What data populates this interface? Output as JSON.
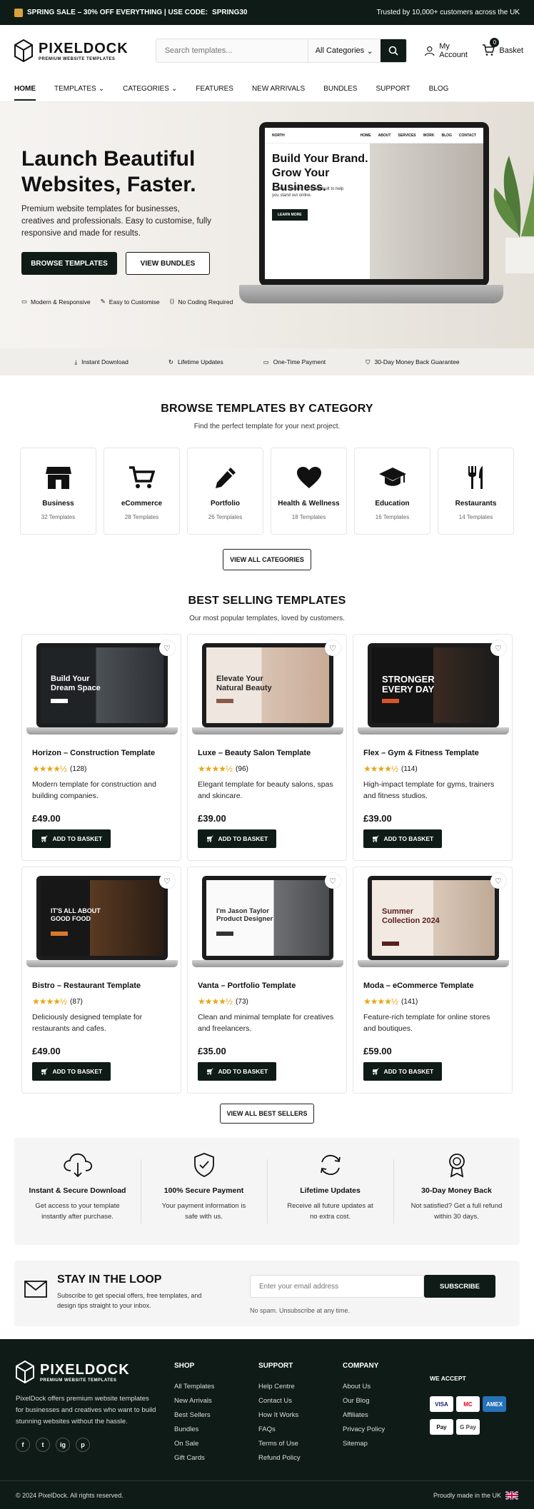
{
  "topbar": {
    "promo": "SPRING SALE – 30% OFF EVERYTHING | USE CODE:",
    "code": "SPRING30",
    "trust": "Trusted by 10,000+ customers across the UK"
  },
  "brand": {
    "name": "PIXELDOCK",
    "tagline": "PREMIUM WEBSITE TEMPLATES"
  },
  "search": {
    "placeholder": "Search templates...",
    "category": "All Categories"
  },
  "header": {
    "account": "My Account",
    "basket": "Basket",
    "basket_count": "0"
  },
  "nav": [
    "HOME",
    "TEMPLATES",
    "CATEGORIES",
    "FEATURES",
    "NEW ARRIVALS",
    "BUNDLES",
    "SUPPORT",
    "BLOG"
  ],
  "hero": {
    "title": "Launch Beautiful Websites, Faster.",
    "description": "Premium website templates for businesses, creatives and professionals. Easy to customise, fully responsive and made for results.",
    "primary_btn": "BROWSE TEMPLATES",
    "secondary_btn": "VIEW BUNDLES",
    "features": [
      "Modern & Responsive",
      "Easy to Customise",
      "No Coding Required"
    ],
    "screen": {
      "brand": "NORTH",
      "nav": [
        "HOME",
        "ABOUT",
        "SERVICES",
        "WORK",
        "BLOG",
        "CONTACT"
      ],
      "title": "Build Your Brand. Grow Your Business.",
      "text": "A clean, modern template built to help you stand out online.",
      "button": "LEARN MORE"
    }
  },
  "trust_bar": [
    "Instant Download",
    "Lifetime Updates",
    "One-Time Payment",
    "30-Day Money Back Guarantee"
  ],
  "categories": {
    "title": "BROWSE TEMPLATES BY CATEGORY",
    "subtitle": "Find the perfect template for your next project.",
    "items": [
      {
        "name": "Business",
        "count": "32 Templates",
        "icon": "store-icon"
      },
      {
        "name": "eCommerce",
        "count": "28 Templates",
        "icon": "cart-icon"
      },
      {
        "name": "Portfolio",
        "count": "26 Templates",
        "icon": "pencil-icon"
      },
      {
        "name": "Health & Wellness",
        "count": "18 Templates",
        "icon": "heart-icon"
      },
      {
        "name": "Education",
        "count": "16 Templates",
        "icon": "graduation-cap-icon"
      },
      {
        "name": "Restaurants",
        "count": "14 Templates",
        "icon": "cutlery-icon"
      }
    ],
    "button": "VIEW ALL CATEGORIES"
  },
  "best": {
    "title": "BEST SELLING TEMPLATES",
    "subtitle": "Our most popular templates, loved by customers.",
    "add_label": "ADD TO BASKET",
    "button": "VIEW ALL BEST SELLERS",
    "products": [
      {
        "name": "Horizon – Construction Template",
        "reviews": "(128)",
        "desc": "Modern template for construction and building companies.",
        "price": "£49.00",
        "screen": "Build Your Dream Space",
        "rating": 4.5
      },
      {
        "name": "Luxe – Beauty Salon Template",
        "reviews": "(96)",
        "desc": "Elegant template for beauty salons, spas and skincare.",
        "price": "£39.00",
        "screen": "Elevate Your Natural Beauty",
        "rating": 4.5
      },
      {
        "name": "Flex – Gym & Fitness Template",
        "reviews": "(114)",
        "desc": "High-impact template for gyms, trainers and fitness studios.",
        "price": "£39.00",
        "screen": "STRONGER EVERY DAY",
        "rating": 4.5
      },
      {
        "name": "Bistro – Restaurant Template",
        "reviews": "(87)",
        "desc": "Deliciously designed template for restaurants and cafes.",
        "price": "£49.00",
        "screen": "IT'S ALL ABOUT GOOD FOOD",
        "rating": 4.5
      },
      {
        "name": "Vanta – Portfolio Template",
        "reviews": "(73)",
        "desc": "Clean and minimal template for creatives and freelancers.",
        "price": "£35.00",
        "screen": "I'm Jason Taylor Product Designer",
        "rating": 4.5
      },
      {
        "name": "Moda – eCommerce Template",
        "reviews": "(141)",
        "desc": "Feature-rich template for online stores and boutiques.",
        "price": "£59.00",
        "screen": "Summer Collection 2024",
        "rating": 4.5
      }
    ]
  },
  "features": [
    {
      "title": "Instant & Secure Download",
      "desc": "Get access to your template instantly after purchase.",
      "icon": "cloud-download-icon"
    },
    {
      "title": "100% Secure Payment",
      "desc": "Your payment information is safe with us.",
      "icon": "shield-check-icon"
    },
    {
      "title": "Lifetime Updates",
      "desc": "Receive all future updates at no extra cost.",
      "icon": "refresh-icon"
    },
    {
      "title": "30-Day Money Back",
      "desc": "Not satisfied? Get a full refund within 30 days.",
      "icon": "award-icon"
    }
  ],
  "newsletter": {
    "title": "STAY IN THE LOOP",
    "desc": "Subscribe to get special offers, free templates, and design tips straight to your inbox.",
    "placeholder": "Enter your email address",
    "button": "SUBSCRIBE",
    "note": "No spam. Unsubscribe at any time."
  },
  "footer": {
    "desc": "PixelDock offers premium website templates for businesses and creatives who want to build stunning websites without the hassle.",
    "social": [
      "f",
      "t",
      "ig",
      "p"
    ],
    "shop": {
      "title": "SHOP",
      "links": [
        "All Templates",
        "New Arrivals",
        "Best Sellers",
        "Bundles",
        "On Sale",
        "Gift Cards"
      ]
    },
    "support": {
      "title": "SUPPORT",
      "links": [
        "Help Centre",
        "Contact Us",
        "How It Works",
        "FAQs",
        "Terms of Use",
        "Refund Policy"
      ]
    },
    "company": {
      "title": "COMPANY",
      "links": [
        "About Us",
        "Our Blog",
        "Affiliates",
        "Privacy Policy",
        "Sitemap"
      ]
    },
    "accept_title": "WE ACCEPT",
    "payments": [
      "VISA",
      "MC",
      "AMEX",
      "Pay",
      "G Pay"
    ],
    "copyright": "© 2024 PixelDock. All rights reserved.",
    "made": "Proudly made in the UK"
  },
  "colors": {
    "primary": "#0f1b17",
    "star": "#e6a619",
    "hero_bg": "#efece7"
  }
}
